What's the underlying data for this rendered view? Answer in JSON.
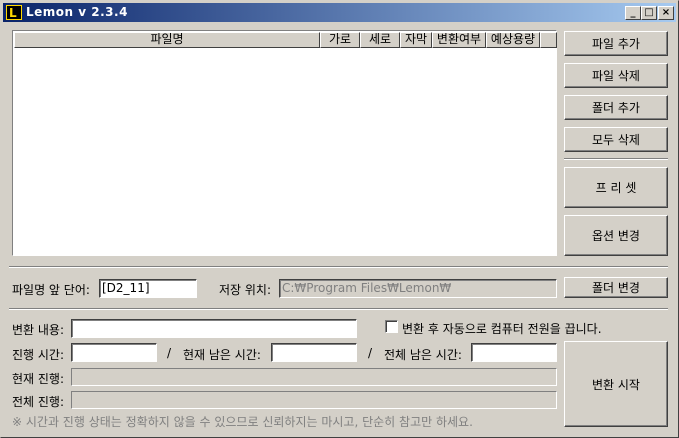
{
  "window": {
    "title": "Lemon v 2.3.4",
    "icon_letter": "L",
    "minimize_glyph": "_",
    "maximize_glyph": "□",
    "close_glyph": "×"
  },
  "file_list": {
    "columns": [
      "파일명",
      "가로",
      "세로",
      "자막",
      "변환여부",
      "예상용량",
      ""
    ]
  },
  "side_buttons": {
    "add_file": "파일 추가",
    "delete_file": "파일 삭제",
    "add_folder": "폴더 추가",
    "delete_all": "모두 삭제",
    "preset": "프 리 셋",
    "change_options": "옵션 변경"
  },
  "options": {
    "prefix_label": "파일명 앞 단어:",
    "prefix_value": "[D2_11]",
    "save_location_label": "저장 위치:",
    "save_location_value": "C:₩Program Files₩Lemon₩",
    "change_folder_button": "폴더 변경"
  },
  "conversion": {
    "content_label": "변환 내용:",
    "content_value": "",
    "shutdown_checkbox_label": "변환 후 자동으로 컴퓨터 전원을 끕니다.",
    "elapsed_label": "진행 시간:",
    "elapsed_value": "",
    "separator": "/",
    "current_remaining_label": "현재 남은 시간:",
    "current_remaining_value": "",
    "total_remaining_label": "전체 남은 시간:",
    "total_remaining_value": "",
    "current_progress_label": "현재 진행:",
    "total_progress_label": "전체 진행:",
    "current_progress": 0,
    "total_progress": 0,
    "start_button": "변환 시작",
    "note": "※ 시간과 진행 상태는 정확하지 않을 수 있으므로 신뢰하지는 마시고, 단순히 참고만 하세요."
  }
}
